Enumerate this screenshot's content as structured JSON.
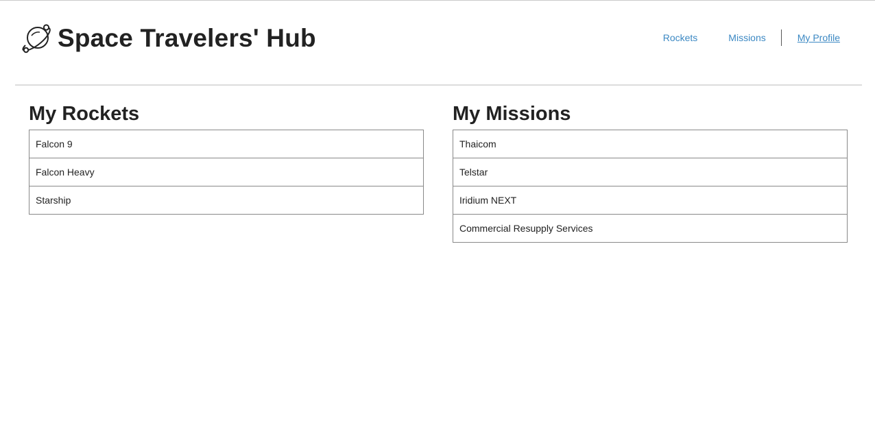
{
  "header": {
    "title": "Space Travelers' Hub",
    "logo_icon": "planet-icon",
    "nav": [
      {
        "label": "Rockets",
        "active": false
      },
      {
        "label": "Missions",
        "active": false
      },
      {
        "label": "My Profile",
        "active": true
      }
    ],
    "link_color": "#3b88c3"
  },
  "rockets": {
    "title": "My Rockets",
    "items": [
      "Falcon 9",
      "Falcon Heavy",
      "Starship"
    ]
  },
  "missions": {
    "title": "My Missions",
    "items": [
      "Thaicom",
      "Telstar",
      "Iridium NEXT",
      "Commercial Resupply Services"
    ]
  }
}
